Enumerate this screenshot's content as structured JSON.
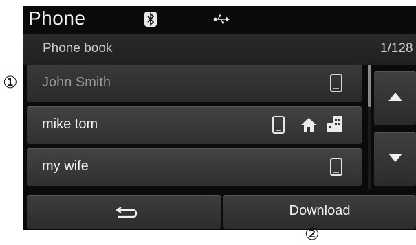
{
  "header": {
    "title": "Phone",
    "icons": [
      "bluetooth-icon",
      "usb-icon"
    ]
  },
  "subheader": {
    "title": "Phone book",
    "page_indicator": "1/128"
  },
  "contacts": [
    {
      "name": "John Smith",
      "selected": true,
      "icons": [
        "mobile-icon"
      ]
    },
    {
      "name": "mike tom",
      "selected": false,
      "icons": [
        "mobile-icon",
        "home-icon",
        "office-icon"
      ]
    },
    {
      "name": "my wife",
      "selected": false,
      "icons": [
        "mobile-icon"
      ]
    }
  ],
  "scroll": {
    "up_icon": "arrow-up-icon",
    "down_icon": "arrow-down-icon"
  },
  "bottom": {
    "back_icon": "back-icon",
    "download_label": "Download"
  },
  "callouts": [
    "①",
    "②"
  ],
  "colors": {
    "screen_bg": "#0b0b0b",
    "button": "#363636",
    "text": "#f0f0f0",
    "dim_text": "#9a9a9a"
  }
}
